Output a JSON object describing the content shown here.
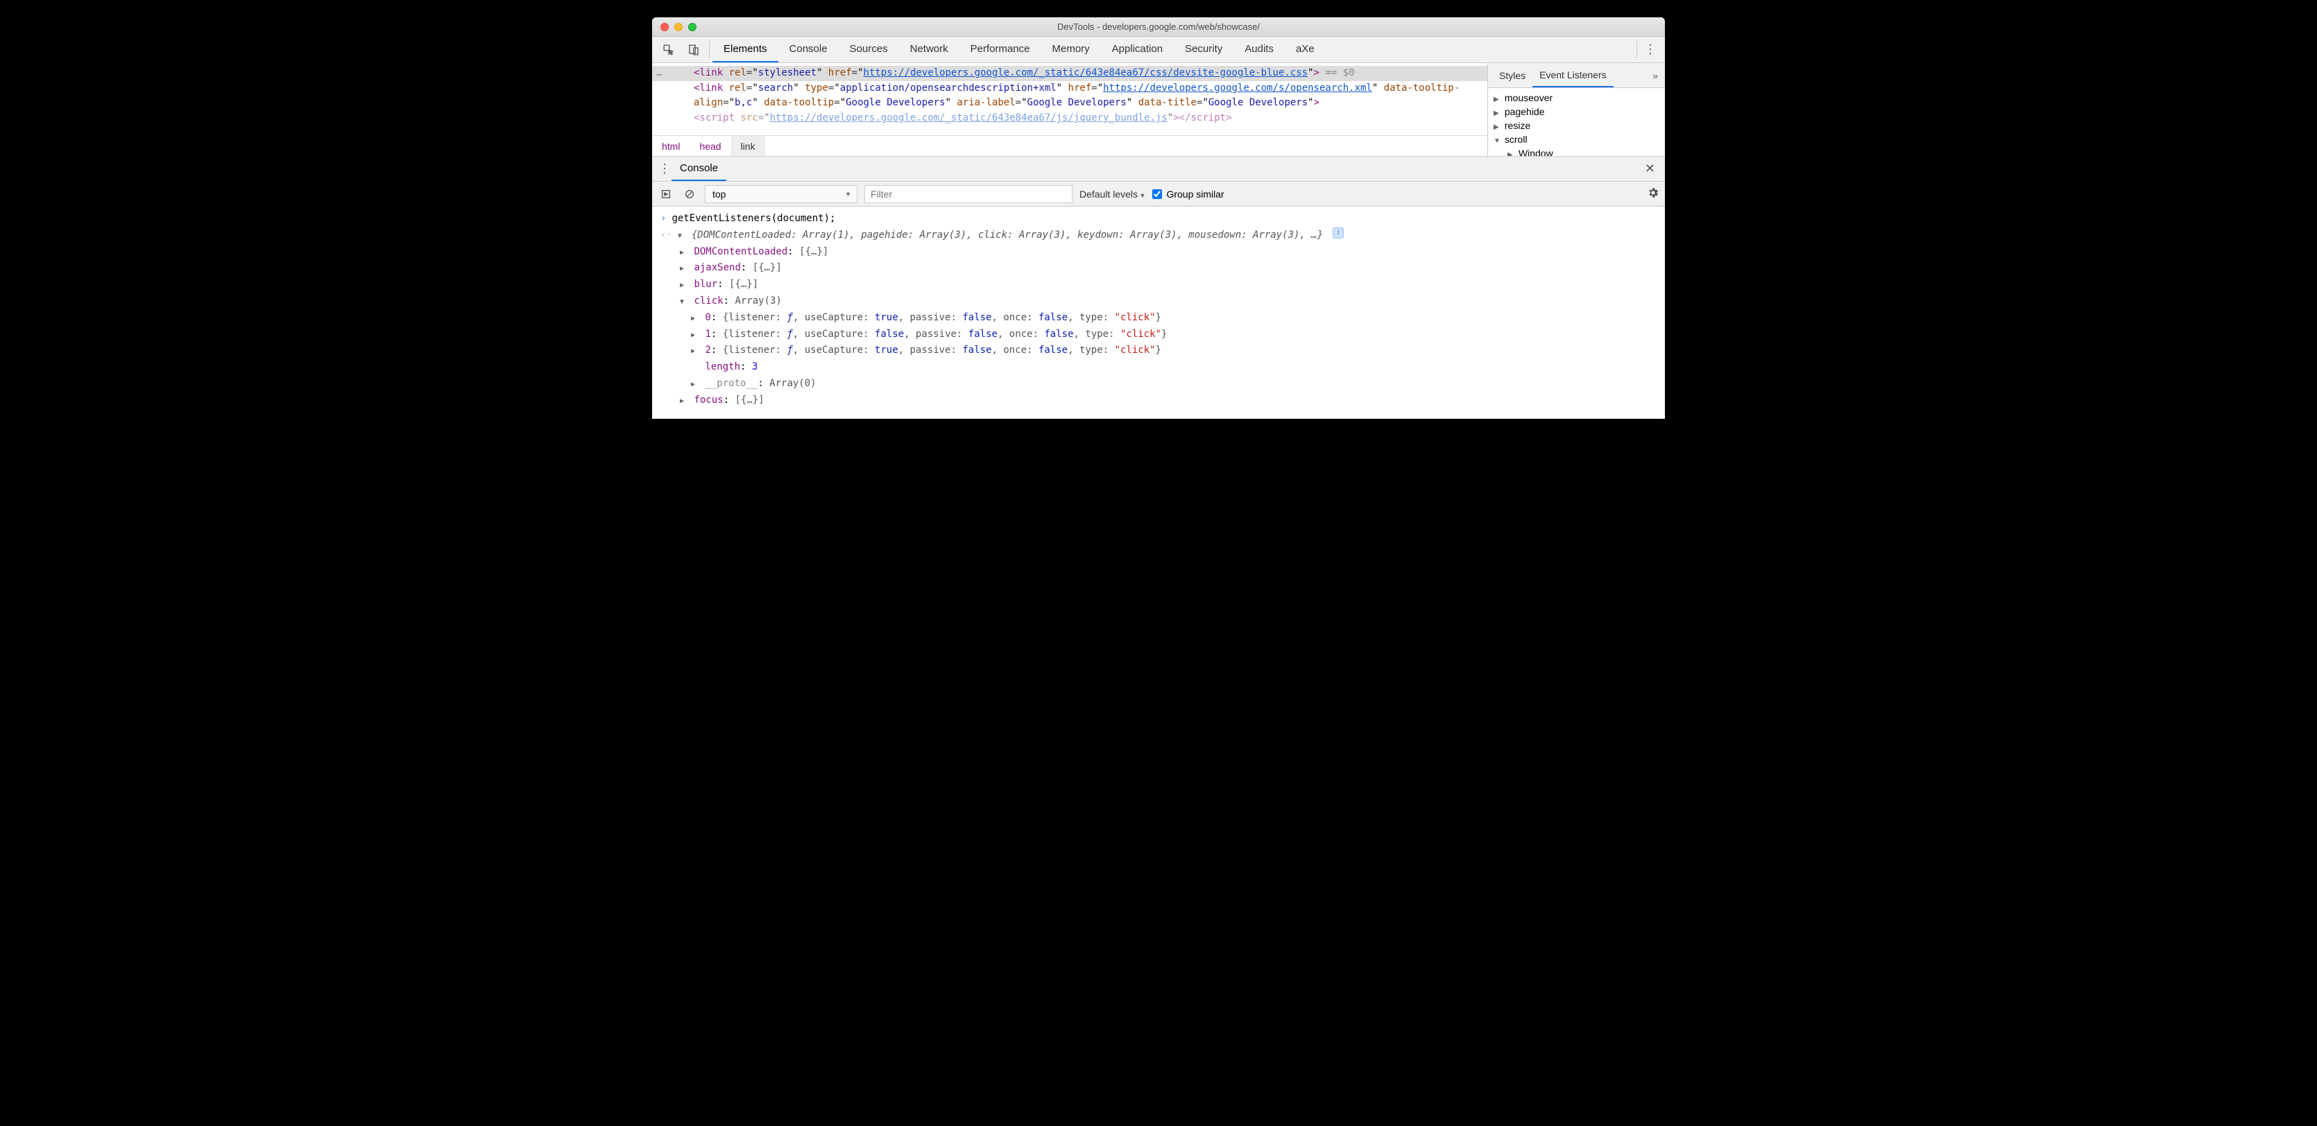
{
  "window_title": "DevTools - developers.google.com/web/showcase/",
  "main_tabs": [
    "Elements",
    "Console",
    "Sources",
    "Network",
    "Performance",
    "Memory",
    "Application",
    "Security",
    "Audits",
    "aXe"
  ],
  "active_main_tab": "Elements",
  "dom": {
    "line1_a": "<link rel=\"stylesheet\" href=\"",
    "line1_link": "https://developers.google.com/_static/643e84ea67/css/devsite-google-blue.css",
    "line1_b": "\"> == $0",
    "line2_a": "<link rel=\"search\" type=\"application/opensearchdescription+xml\" href=\"",
    "line2_link": "https://developers.google.com/s/opensearch.xml",
    "line2_b": "\" data-tooltip-align=\"b,c\" data-tooltip=\"Google Developers\" aria-label=\"Google Developers\" data-title=\"Google Developers\">",
    "line3": "<script src=\"https://developers.google.com/_static/643e84ea67/js/jquery_bundle.js\"></script>"
  },
  "breadcrumbs": [
    "html",
    "head",
    "link"
  ],
  "sidebar_tabs": [
    "Styles",
    "Event Listeners"
  ],
  "active_sidebar_tab": "Event Listeners",
  "listeners": [
    {
      "name": "mouseover",
      "expanded": false
    },
    {
      "name": "pagehide",
      "expanded": false
    },
    {
      "name": "resize",
      "expanded": false
    },
    {
      "name": "scroll",
      "expanded": true,
      "children": [
        "Window"
      ]
    }
  ],
  "drawer_tab": "Console",
  "context": "top",
  "filter_placeholder": "Filter",
  "levels": "Default levels",
  "group_similar": "Group similar",
  "console": {
    "input": "getEventListeners(document);",
    "summary": "{DOMContentLoaded: Array(1), pagehide: Array(3), click: Array(3), keydown: Array(3), mousedown: Array(3), …}",
    "rows": [
      {
        "k": "DOMContentLoaded",
        "v": "[{…}]",
        "tri": "right"
      },
      {
        "k": "ajaxSend",
        "v": "[{…}]",
        "tri": "right"
      },
      {
        "k": "blur",
        "v": "[{…}]",
        "tri": "right"
      }
    ],
    "click_label": "click",
    "click_val": "Array(3)",
    "click_items": [
      {
        "idx": "0",
        "useCapture": "true",
        "passive": "false",
        "once": "false",
        "type": "\"click\""
      },
      {
        "idx": "1",
        "useCapture": "false",
        "passive": "false",
        "once": "false",
        "type": "\"click\""
      },
      {
        "idx": "2",
        "useCapture": "true",
        "passive": "false",
        "once": "false",
        "type": "\"click\""
      }
    ],
    "length_label": "length",
    "length_val": "3",
    "proto_label": "__proto__",
    "proto_val": "Array(0)",
    "focus_label": "focus",
    "focus_val": "[{…}]"
  }
}
